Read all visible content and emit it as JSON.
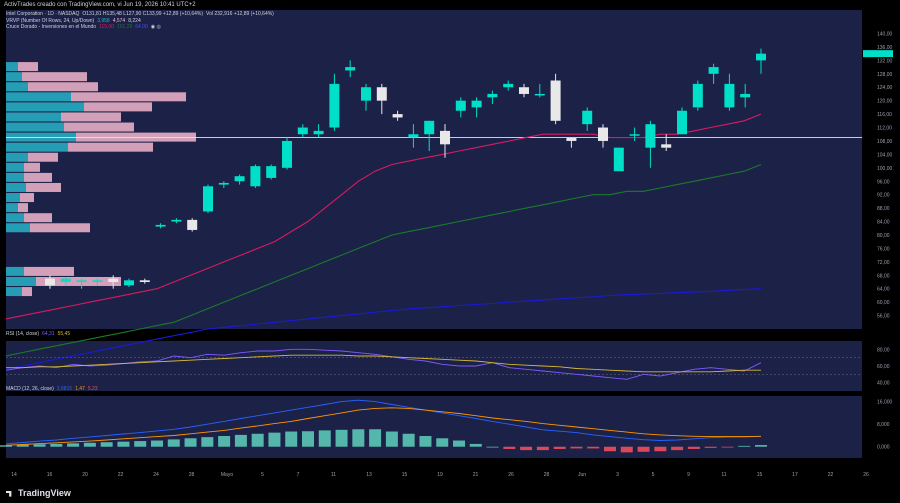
{
  "header": {
    "text": "ActivTrades creado con TradingView.com, vi Jun 19, 2026 10:41 UTC+2"
  },
  "legend": {
    "symbol": "Intel Corporation · 1D · NASDAQ",
    "ohlc": "O131,81  H135,48  L127,90  C133,99  +12,89 (+10,64%)",
    "volume": "Vol 232,916  +12,89 (+10,64%)",
    "vrvp": "VRVP (Number Of Rows, 24, Up/Down)",
    "vrvp_vals": [
      "3,958",
      "4,574",
      "8,224"
    ],
    "ma_title": "Cruce Dorado - Inversiones en el Mundo",
    "ma_vals": [
      "115,00",
      "101,29",
      "64,00"
    ],
    "rsi_title": "RSI (14, close)",
    "rsi_vals": [
      "64,31",
      "55,45"
    ],
    "macd_title": "MACD (12, 26, close)",
    "macd_vals": [
      "3,6815",
      "1,47",
      "5,23"
    ]
  },
  "colors": {
    "up": "#00e0c8",
    "down": "#e8e8e8",
    "ma_fast": "#d81b60",
    "ma_mid": "#1b7a2a",
    "ma_slow": "#1a1ad8",
    "rsi_line": "#7f5aff",
    "rsi_ma": "#d4b73a",
    "macd_line": "#2962ff",
    "signal_line": "#ff9800",
    "hist_pos": "#5cc7b6",
    "hist_neg": "#f04c5c",
    "vp_up": "#27b3c8",
    "vp_down": "#f2b6cc",
    "pane_bg": "#1c2147"
  },
  "chart_data": [
    {
      "type": "candlestick",
      "title": "Intel Corporation · 1D · NASDAQ",
      "x_ticks": [
        "14",
        "16",
        "20",
        "22",
        "24",
        "28",
        "Mayo",
        "5",
        "7",
        "11",
        "13",
        "15",
        "19",
        "21",
        "26",
        "28",
        "Jun",
        "3",
        "5",
        "9",
        "11",
        "15",
        "17",
        "22",
        "26"
      ],
      "ylim": [
        52,
        147
      ],
      "y_ticks": [
        "140,00",
        "136,00",
        "132,00",
        "128,00",
        "124,00",
        "120,00",
        "116,00",
        "112,00",
        "108,00",
        "104,00",
        "100,00",
        "96,00",
        "92,00",
        "88,00",
        "84,00",
        "80,00",
        "76,00",
        "72,00",
        "68,00",
        "64,00",
        "60,00",
        "56,00"
      ],
      "price_line": 109,
      "candles": [
        {
          "o": 67,
          "h": 68,
          "l": 64,
          "c": 65
        },
        {
          "o": 66,
          "h": 67.5,
          "l": 65,
          "c": 67
        },
        {
          "o": 66,
          "h": 67,
          "l": 64,
          "c": 66.5
        },
        {
          "o": 66,
          "h": 67,
          "l": 65,
          "c": 66.5
        },
        {
          "o": 67,
          "h": 68,
          "l": 64,
          "c": 66
        },
        {
          "o": 65,
          "h": 67,
          "l": 64.5,
          "c": 66.5
        },
        {
          "o": 66.5,
          "h": 67,
          "l": 65.5,
          "c": 66
        },
        {
          "o": 82.5,
          "h": 83.5,
          "l": 82,
          "c": 83
        },
        {
          "o": 84,
          "h": 85,
          "l": 83.5,
          "c": 84.5
        },
        {
          "o": 84.5,
          "h": 85,
          "l": 81,
          "c": 81.5
        },
        {
          "o": 87,
          "h": 95,
          "l": 86.5,
          "c": 94.5
        },
        {
          "o": 95,
          "h": 96,
          "l": 94,
          "c": 95.5
        },
        {
          "o": 96,
          "h": 98,
          "l": 95,
          "c": 97.5
        },
        {
          "o": 94.5,
          "h": 101,
          "l": 94,
          "c": 100.5
        },
        {
          "o": 97,
          "h": 101,
          "l": 96.5,
          "c": 100.5
        },
        {
          "o": 100,
          "h": 109,
          "l": 99.5,
          "c": 108
        },
        {
          "o": 110,
          "h": 113,
          "l": 109,
          "c": 112
        },
        {
          "o": 110,
          "h": 113,
          "l": 109,
          "c": 111
        },
        {
          "o": 112,
          "h": 128,
          "l": 111,
          "c": 125
        },
        {
          "o": 129,
          "h": 132,
          "l": 127,
          "c": 130
        },
        {
          "o": 120,
          "h": 125,
          "l": 117,
          "c": 124
        },
        {
          "o": 124,
          "h": 125,
          "l": 116,
          "c": 120
        },
        {
          "o": 116,
          "h": 117,
          "l": 114,
          "c": 115
        },
        {
          "o": 109,
          "h": 113,
          "l": 106,
          "c": 110
        },
        {
          "o": 110,
          "h": 114,
          "l": 105,
          "c": 114
        },
        {
          "o": 111,
          "h": 113,
          "l": 103,
          "c": 107
        },
        {
          "o": 117,
          "h": 121,
          "l": 115,
          "c": 120
        },
        {
          "o": 118,
          "h": 121,
          "l": 115,
          "c": 120
        },
        {
          "o": 121,
          "h": 123,
          "l": 119,
          "c": 122
        },
        {
          "o": 124,
          "h": 126,
          "l": 123,
          "c": 125
        },
        {
          "o": 124,
          "h": 125,
          "l": 121,
          "c": 122
        },
        {
          "o": 122,
          "h": 125,
          "l": 121,
          "c": 122
        },
        {
          "o": 126,
          "h": 128,
          "l": 113,
          "c": 114
        },
        {
          "o": 109,
          "h": 109,
          "l": 106,
          "c": 108
        },
        {
          "o": 113,
          "h": 118,
          "l": 111,
          "c": 117
        },
        {
          "o": 112,
          "h": 113,
          "l": 106,
          "c": 108
        },
        {
          "o": 99,
          "h": 106,
          "l": 99,
          "c": 106
        },
        {
          "o": 110,
          "h": 112,
          "l": 108,
          "c": 110
        },
        {
          "o": 106,
          "h": 114,
          "l": 100,
          "c": 113
        },
        {
          "o": 107,
          "h": 110,
          "l": 105,
          "c": 106
        },
        {
          "o": 110,
          "h": 118,
          "l": 110,
          "c": 117
        },
        {
          "o": 118,
          "h": 126,
          "l": 117,
          "c": 125
        },
        {
          "o": 128,
          "h": 131,
          "l": 125,
          "c": 130
        },
        {
          "o": 118,
          "h": 128,
          "l": 117,
          "c": 125
        },
        {
          "o": 121,
          "h": 125,
          "l": 118,
          "c": 122
        },
        {
          "o": 132,
          "h": 135.5,
          "l": 128,
          "c": 134
        }
      ],
      "series": [
        {
          "name": "115,00",
          "values": [
            55,
            56,
            57,
            58,
            59,
            60,
            61,
            62,
            63,
            64,
            66,
            68,
            70,
            72,
            74,
            76,
            78,
            81,
            84,
            88,
            92,
            96,
            99,
            101,
            102,
            103,
            104,
            105,
            106,
            107,
            108,
            109,
            110,
            110,
            110,
            110,
            109,
            109,
            109,
            110,
            110,
            111,
            112,
            113,
            114,
            116
          ]
        },
        {
          "name": "101,29",
          "values": [
            44,
            45,
            46,
            47,
            48,
            49,
            50,
            51,
            52,
            53,
            54,
            56,
            58,
            60,
            62,
            64,
            66,
            68,
            70,
            72,
            74,
            76,
            78,
            80,
            81,
            82,
            83,
            84,
            85,
            86,
            87,
            88,
            89,
            90,
            91,
            92,
            92,
            93,
            93,
            94,
            95,
            96,
            97,
            98,
            99,
            101
          ]
        },
        {
          "name": "64,00",
          "values": [
            40,
            41,
            42,
            43,
            44,
            45,
            46,
            47,
            48,
            49,
            50,
            51,
            52,
            52.5,
            53,
            53.5,
            54,
            54.5,
            55,
            55.5,
            56,
            56.5,
            57,
            57.5,
            58,
            58.3,
            58.6,
            59,
            59.3,
            59.6,
            60,
            60.3,
            60.6,
            61,
            61.3,
            61.6,
            62,
            62.2,
            62.4,
            62.6,
            62.8,
            63,
            63.2,
            63.5,
            63.8,
            64
          ]
        }
      ],
      "volume_profile": [
        {
          "price": 130,
          "up": 12,
          "down": 20
        },
        {
          "price": 127,
          "up": 16,
          "down": 65
        },
        {
          "price": 124,
          "up": 22,
          "down": 70
        },
        {
          "price": 121,
          "up": 65,
          "down": 115
        },
        {
          "price": 118,
          "up": 78,
          "down": 68
        },
        {
          "price": 115,
          "up": 55,
          "down": 60
        },
        {
          "price": 112,
          "up": 58,
          "down": 70
        },
        {
          "price": 109,
          "up": 70,
          "down": 120
        },
        {
          "price": 106,
          "up": 62,
          "down": 85
        },
        {
          "price": 103,
          "up": 22,
          "down": 30
        },
        {
          "price": 100,
          "up": 18,
          "down": 16
        },
        {
          "price": 97,
          "up": 18,
          "down": 28
        },
        {
          "price": 94,
          "up": 20,
          "down": 35
        },
        {
          "price": 91,
          "up": 14,
          "down": 14
        },
        {
          "price": 88,
          "up": 12,
          "down": 10
        },
        {
          "price": 85,
          "up": 18,
          "down": 28
        },
        {
          "price": 82,
          "up": 24,
          "down": 60
        },
        {
          "price": 69,
          "up": 18,
          "down": 50
        },
        {
          "price": 66,
          "up": 30,
          "down": 85
        },
        {
          "price": 63,
          "up": 16,
          "down": 10
        }
      ]
    },
    {
      "type": "line",
      "title": "RSI (14, close)",
      "ylim": [
        30,
        90
      ],
      "y_ticks": [
        "80,00",
        "60,00",
        "40,00"
      ],
      "series": [
        {
          "name": "64,31",
          "values": [
            55,
            58,
            60,
            58,
            62,
            60,
            61,
            63,
            65,
            66,
            72,
            70,
            74,
            73,
            76,
            78,
            78,
            80,
            80,
            79,
            78,
            76,
            74,
            71,
            68,
            66,
            62,
            60,
            60,
            64,
            58,
            56,
            54,
            52,
            50,
            48,
            46,
            44,
            50,
            48,
            52,
            56,
            58,
            56,
            54,
            64
          ]
        },
        {
          "name": "55,45",
          "values": [
            58,
            58,
            59,
            59,
            60,
            61,
            62,
            63,
            64,
            65,
            66,
            67,
            68,
            69,
            70,
            71,
            72,
            73,
            73,
            73,
            73,
            72,
            72,
            71,
            70,
            69,
            68,
            67,
            66,
            64,
            62,
            61,
            60,
            59,
            57,
            56,
            55,
            54,
            53,
            53,
            53,
            53,
            53,
            54,
            55,
            55
          ]
        }
      ]
    },
    {
      "type": "bar",
      "title": "MACD (12, 26, close)",
      "ylim": [
        -4,
        18
      ],
      "y_ticks": [
        "16,000",
        "8,000",
        "0,000"
      ],
      "histogram": [
        0.5,
        0.7,
        0.9,
        1,
        1.2,
        1.4,
        1.6,
        1.8,
        2,
        2.2,
        2.6,
        3,
        3.4,
        3.8,
        4.2,
        4.6,
        5,
        5.4,
        5.5,
        5.8,
        6,
        6.2,
        6.2,
        5.4,
        4.6,
        3.8,
        3,
        2.2,
        1,
        0,
        -0.8,
        -1.2,
        -1.2,
        -0.8,
        -0.6,
        -0.6,
        -1.6,
        -2,
        -1.8,
        -1.6,
        -1.2,
        -0.8,
        -0.4,
        -0.1,
        0.3,
        0.6
      ],
      "series": [
        {
          "name": "3,6815",
          "values": [
            1,
            1.5,
            2,
            2.4,
            3,
            3.5,
            4,
            4.5,
            5,
            5.6,
            6.2,
            7,
            8,
            9,
            10,
            11,
            12,
            13,
            14,
            15,
            16,
            16.5,
            16,
            15,
            14,
            13,
            12,
            11,
            10,
            9,
            8,
            7,
            6,
            5.5,
            5,
            4.2,
            3.6,
            3,
            2.5,
            2.2,
            2.4,
            2.8,
            3.2,
            3.4,
            3.5,
            3.7
          ]
        },
        {
          "name": "1,47",
          "values": [
            0.5,
            0.8,
            1.1,
            1.4,
            1.7,
            2,
            2.4,
            2.8,
            3.2,
            3.6,
            4,
            4.6,
            5.2,
            5.8,
            6.6,
            7.4,
            8.2,
            9,
            10,
            11,
            12,
            13,
            13.6,
            13.8,
            13.6,
            13,
            12.4,
            11.8,
            11,
            10.2,
            9.6,
            9,
            8.2,
            7.6,
            7,
            6.4,
            5.8,
            5.2,
            4.6,
            4.2,
            3.9,
            3.7,
            3.6,
            3.6,
            3.6,
            3.7
          ]
        }
      ]
    }
  ]
}
